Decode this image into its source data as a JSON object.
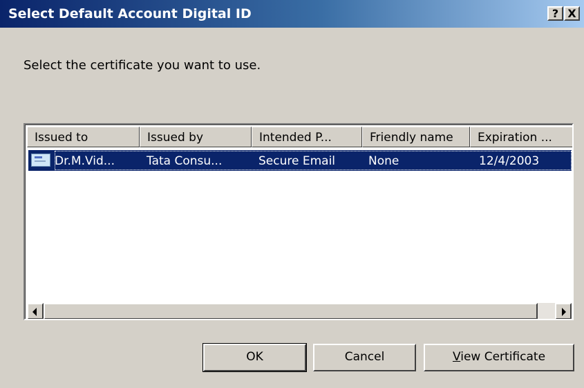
{
  "window": {
    "title": "Select Default Account Digital ID",
    "help_label": "?",
    "close_label": "X"
  },
  "prompt": "Select the certificate you want to use.",
  "table": {
    "columns": [
      "Issued to",
      "Issued by",
      "Intended P...",
      "Friendly name",
      "Expiration ..."
    ],
    "rows": [
      {
        "icon": "certificate-icon",
        "issued_to": "Dr.M.Vid...",
        "issued_by": "Tata Consu...",
        "intended_purpose": "Secure Email",
        "friendly_name": "None",
        "expiration": "12/4/2003",
        "selected": true
      }
    ]
  },
  "buttons": {
    "ok": "OK",
    "cancel": "Cancel",
    "view_certificate_accel": "V",
    "view_certificate_rest": "iew Certificate"
  },
  "colors": {
    "title_bar_start": "#0a246a",
    "title_bar_end": "#a6caf0",
    "selection": "#0a246a",
    "dialog_face": "#d4d0c8"
  }
}
